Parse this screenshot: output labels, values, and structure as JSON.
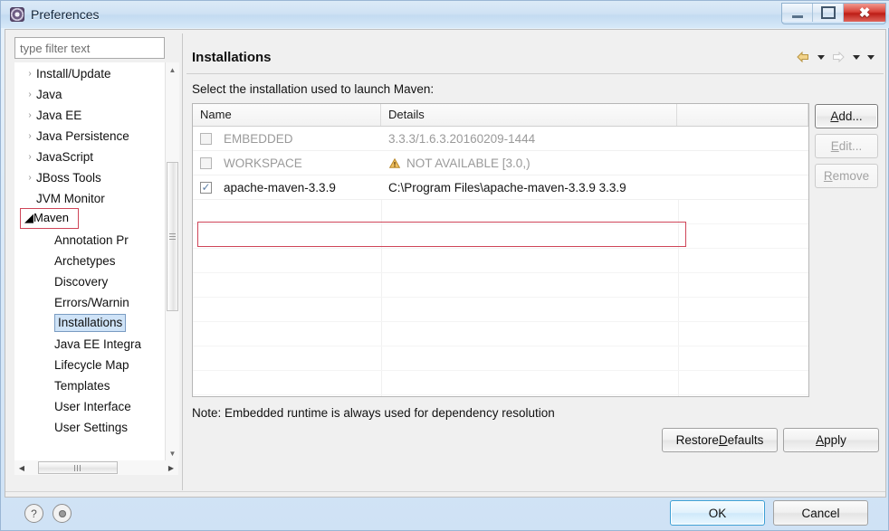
{
  "window": {
    "title": "Preferences",
    "icon": "preferences-gear-icon",
    "controls": {
      "minimize": "minimize-icon",
      "restore": "restore-icon",
      "close": "close-icon"
    }
  },
  "sidebar": {
    "filter": {
      "placeholder": "type filter text",
      "value": ""
    },
    "items": [
      {
        "label": "Install/Update",
        "twisty": "›",
        "level": 0,
        "selected": false,
        "highlighted": false
      },
      {
        "label": "Java",
        "twisty": "›",
        "level": 0,
        "selected": false,
        "highlighted": false
      },
      {
        "label": "Java EE",
        "twisty": "›",
        "level": 0,
        "selected": false,
        "highlighted": false
      },
      {
        "label": "Java Persistence",
        "twisty": "›",
        "level": 0,
        "selected": false,
        "highlighted": false
      },
      {
        "label": "JavaScript",
        "twisty": "›",
        "level": 0,
        "selected": false,
        "highlighted": false
      },
      {
        "label": "JBoss Tools",
        "twisty": "›",
        "level": 0,
        "selected": false,
        "highlighted": false
      },
      {
        "label": "JVM Monitor",
        "twisty": "",
        "level": 0,
        "selected": false,
        "highlighted": false
      },
      {
        "label": "Maven",
        "twisty": "◢",
        "level": 0,
        "selected": false,
        "highlighted": true
      },
      {
        "label": "Annotation Pr",
        "twisty": "",
        "level": 1,
        "selected": false,
        "highlighted": false
      },
      {
        "label": "Archetypes",
        "twisty": "",
        "level": 1,
        "selected": false,
        "highlighted": false
      },
      {
        "label": "Discovery",
        "twisty": "",
        "level": 1,
        "selected": false,
        "highlighted": false
      },
      {
        "label": "Errors/Warnin",
        "twisty": "",
        "level": 1,
        "selected": false,
        "highlighted": false
      },
      {
        "label": "Installations",
        "twisty": "",
        "level": 1,
        "selected": true,
        "highlighted": false
      },
      {
        "label": "Java EE Integra",
        "twisty": "",
        "level": 1,
        "selected": false,
        "highlighted": false
      },
      {
        "label": "Lifecycle Map",
        "twisty": "",
        "level": 1,
        "selected": false,
        "highlighted": false
      },
      {
        "label": "Templates",
        "twisty": "",
        "level": 1,
        "selected": false,
        "highlighted": false
      },
      {
        "label": "User Interface",
        "twisty": "",
        "level": 1,
        "selected": false,
        "highlighted": false
      },
      {
        "label": "User Settings",
        "twisty": "",
        "level": 1,
        "selected": false,
        "highlighted": false
      }
    ],
    "vscroll": {
      "up": "▲",
      "down": "▼"
    },
    "hscroll": {
      "left": "◀",
      "right": "▶"
    }
  },
  "page": {
    "title": "Installations",
    "subtitle": "Select the installation used to launch Maven:",
    "note": "Note: Embedded runtime is always used for dependency resolution",
    "nav": {
      "back": "back-arrow-icon",
      "back_menu": "back-dropdown-icon",
      "forward": "forward-arrow-icon",
      "forward_menu": "forward-dropdown-icon",
      "view_menu": "view-menu-icon"
    }
  },
  "table": {
    "columns": [
      "Name",
      "Details",
      ""
    ],
    "rows": [
      {
        "checked": false,
        "enabled": false,
        "name": "EMBEDDED",
        "details": "3.3.3/1.6.3.20160209-1444",
        "warning": false,
        "highlighted": false
      },
      {
        "checked": false,
        "enabled": false,
        "name": "WORKSPACE",
        "details": "NOT AVAILABLE [3.0,)",
        "warning": true,
        "highlighted": false
      },
      {
        "checked": true,
        "enabled": true,
        "name": "apache-maven-3.3.9",
        "details": "C:\\Program Files\\apache-maven-3.3.9 3.3.9",
        "warning": false,
        "highlighted": true
      }
    ],
    "empty_rows": 9,
    "check_glyph": "✓"
  },
  "side_buttons": [
    {
      "id": "add",
      "label": "Add...",
      "mnemonic": "A",
      "enabled": true,
      "focused": true
    },
    {
      "id": "edit",
      "label": "Edit...",
      "mnemonic": "E",
      "enabled": false,
      "focused": false
    },
    {
      "id": "remove",
      "label": "Remove",
      "mnemonic": "R",
      "enabled": false,
      "focused": false
    }
  ],
  "page_buttons": {
    "restore_defaults": {
      "pre": "Restore ",
      "mnemonic": "D",
      "post": "efaults"
    },
    "apply": {
      "pre": "",
      "mnemonic": "A",
      "post": "pply"
    }
  },
  "footer": {
    "help_icon": "help-icon",
    "help_glyph": "?",
    "pin_icon": "pin-icon",
    "ok": "OK",
    "cancel": "Cancel"
  },
  "colors": {
    "highlight_red": "#cf4558",
    "selection_blue": "#cfe3f7",
    "default_button_blue": "#3c9fd4",
    "warning_amber": "#e8a33d"
  }
}
